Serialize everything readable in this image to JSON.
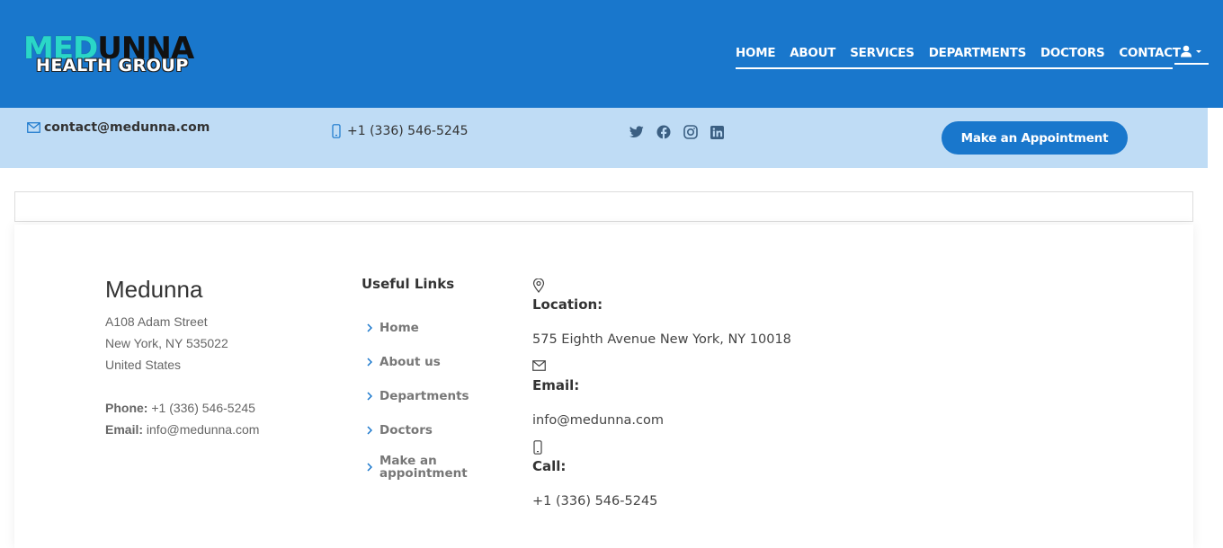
{
  "header": {
    "logo_top_a": "MED",
    "logo_top_b": "UNNA",
    "logo_bottom": "HEALTH GROUP",
    "nav": [
      "HOME",
      "ABOUT",
      "SERVICES",
      "DEPARTMENTS",
      "DOCTORS",
      "CONTACT"
    ],
    "user_icon": "user-icon",
    "colors": {
      "primary": "#1977cc",
      "topbar": "#bfdcf5"
    }
  },
  "topbar": {
    "email": "contact@medunna.com",
    "phone": "+1 (336) 546-5245",
    "social": [
      "twitter-icon",
      "facebook-icon",
      "instagram-icon",
      "linkedin-icon"
    ],
    "appointment_button": "Make an Appointment"
  },
  "footer": {
    "brand": "Medunna",
    "address": [
      "A108 Adam Street",
      "New York, NY 535022",
      "United States"
    ],
    "phone_label": "Phone:",
    "phone": "+1 (336) 546-5245",
    "email_label": "Email:",
    "email": "info@medunna.com",
    "useful_links_title": "Useful Links",
    "links": [
      "Home",
      "About us",
      "Departments",
      "Doctors",
      "Make an appointment"
    ],
    "location_title": "Location:",
    "location": "575 Eighth Avenue New York, NY 10018",
    "email_title": "Email:",
    "email_value": "info@medunna.com",
    "call_title": "Call:",
    "call_value": "+1 (336) 546-5245"
  }
}
